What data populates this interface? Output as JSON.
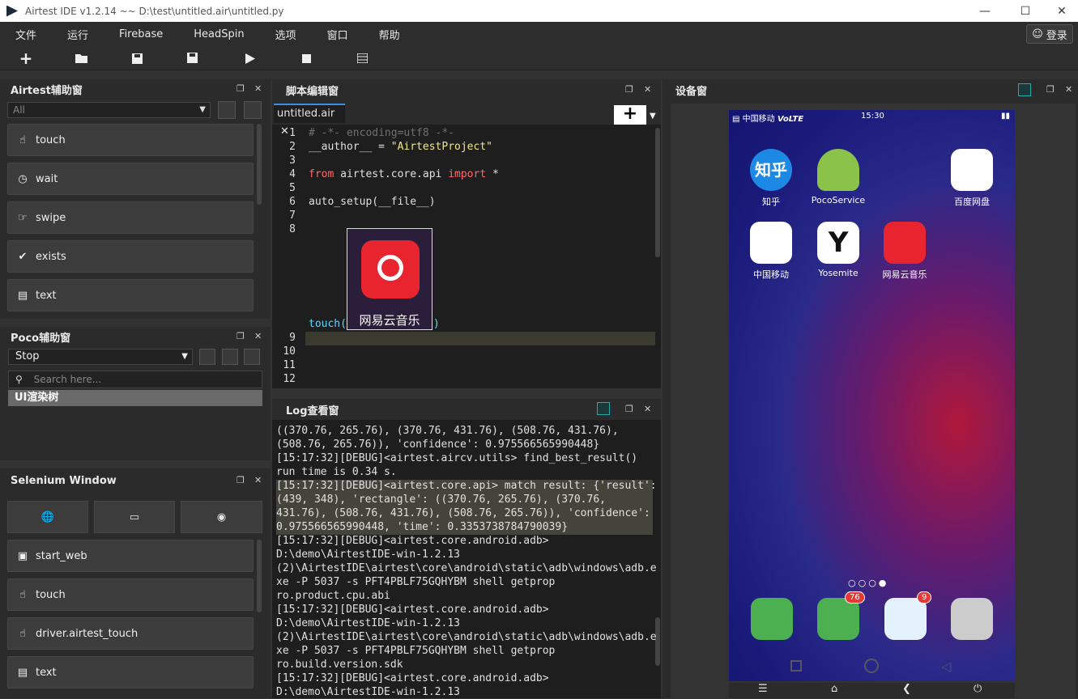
{
  "window": {
    "title": "Airtest IDE v1.2.14 ~~ D:\\test\\untitled.air\\untitled.py"
  },
  "menu": [
    "文件",
    "运行",
    "Firebase",
    "HeadSpin",
    "选项",
    "窗口",
    "帮助"
  ],
  "login_label": "登录",
  "airtest_panel": {
    "title": "Airtest辅助窗",
    "filter": "All",
    "buttons": [
      "touch",
      "wait",
      "swipe",
      "exists",
      "text"
    ]
  },
  "poco_panel": {
    "title": "Poco辅助窗",
    "mode": "Stop",
    "search_placeholder": "Search here...",
    "tree_root": "UI渲染树"
  },
  "selenium_panel": {
    "title": "Selenium Window",
    "buttons": [
      "start_web",
      "touch",
      "driver.airtest_touch",
      "text"
    ]
  },
  "editor": {
    "title": "脚本编辑窗",
    "tab": "untitled.air",
    "line_numbers": [
      "1",
      "2",
      "3",
      "4",
      "5",
      "6",
      "7",
      "8",
      "9",
      "10",
      "11",
      "12"
    ],
    "line1": "# -*- encoding=utf8 -*-",
    "line2a": "__author__ = ",
    "line2b": "\"AirtestProject\"",
    "line4a": "from",
    "line4b": " airtest.core.api ",
    "line4c": "import",
    "line4d": " *",
    "line6": "auto_setup(__file__)",
    "line8a": "touch(",
    "line8b": ")",
    "image_caption": "网易云音乐"
  },
  "log": {
    "title": "Log查看窗",
    "lines": [
      "((370.76, 265.76), (370.76, 431.76), (508.76, 431.76),",
      "(508.76, 265.76)), 'confidence': 0.975566565990448}",
      "[15:17:32][DEBUG]<airtest.aircv.utils> find_best_result()",
      "run time is 0.34 s.",
      "[15:17:32][DEBUG]<airtest.core.api> match result: {'result':",
      "(439, 348), 'rectangle': ((370.76, 265.76), (370.76,",
      "431.76), (508.76, 431.76), (508.76, 265.76)), 'confidence':",
      "0.975566565990448, 'time': 0.3353738784790039}",
      "[15:17:32][DEBUG]<airtest.core.android.adb>",
      "D:\\demo\\AirtestIDE-win-1.2.13",
      "(2)\\AirtestIDE\\airtest\\core\\android\\static\\adb\\windows\\adb.e",
      "xe -P 5037 -s PFT4PBLF75GQHYBM shell getprop",
      "ro.product.cpu.abi",
      "[15:17:32][DEBUG]<airtest.core.android.adb>",
      "D:\\demo\\AirtestIDE-win-1.2.13",
      "(2)\\AirtestIDE\\airtest\\core\\android\\static\\adb\\windows\\adb.e",
      "xe -P 5037 -s PFT4PBLF75GQHYBM shell getprop",
      "ro.build.version.sdk",
      "[15:17:32][DEBUG]<airtest.core.android.adb>",
      "D:\\demo\\AirtestIDE-win-1.2.13"
    ]
  },
  "device": {
    "title": "设备窗",
    "status_left": "中国移动",
    "status_net": "VoLTE",
    "time": "15:30",
    "apps": [
      {
        "label": "知乎",
        "icon_text": "知乎"
      },
      {
        "label": "PocoService"
      },
      {
        "label": "百度网盘"
      },
      {
        "label": "中国移动"
      },
      {
        "label": "Yosemite",
        "icon_text": "Y"
      },
      {
        "label": "网易云音乐"
      }
    ],
    "badges": [
      "76",
      "9"
    ]
  }
}
